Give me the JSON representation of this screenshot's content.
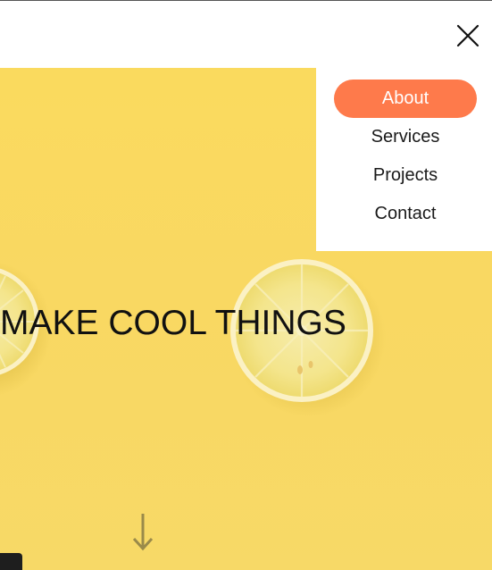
{
  "header": {
    "close_icon": "close-icon"
  },
  "nav": {
    "items": [
      {
        "label": "About",
        "active": true
      },
      {
        "label": "Services",
        "active": false
      },
      {
        "label": "Projects",
        "active": false
      },
      {
        "label": "Contact",
        "active": false
      }
    ]
  },
  "hero": {
    "title": "MAKE COOL THINGS",
    "scroll_icon": "arrow-down-icon"
  },
  "colors": {
    "accent": "#fe7a4b",
    "hero_background": "#fada5e",
    "lemon": "#f7ec9a"
  }
}
